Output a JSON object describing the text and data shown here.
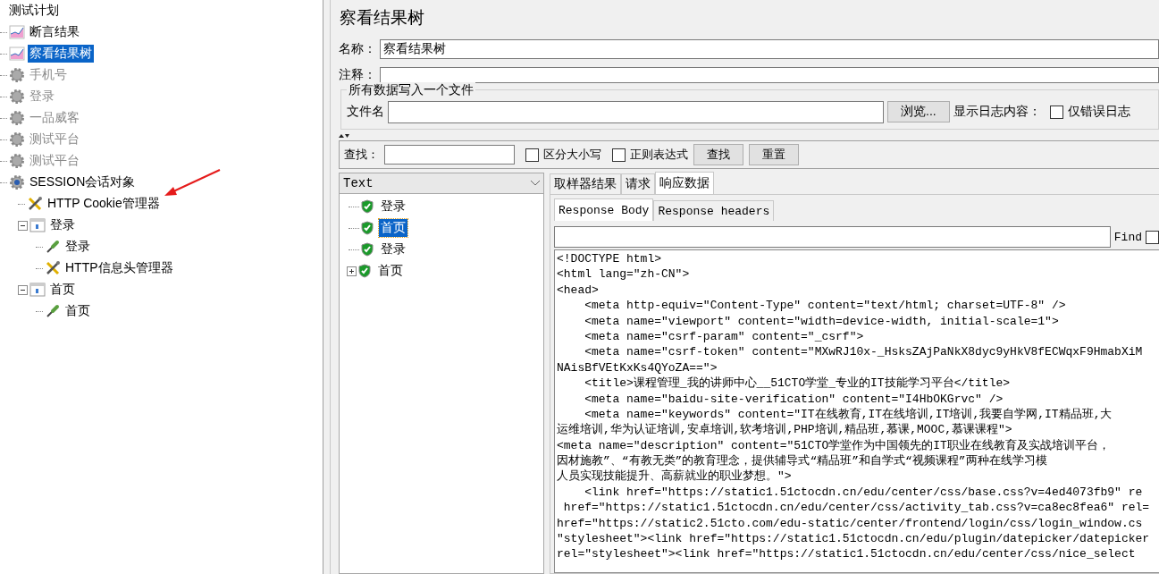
{
  "test_tree": {
    "label": "测试计划",
    "children": [
      {
        "label": "断言结果",
        "kind": "visualizer",
        "selected": false,
        "disabled": false
      },
      {
        "label": "察看结果树",
        "kind": "visualizer",
        "selected": true,
        "disabled": false
      },
      {
        "label": "手机号",
        "kind": "thread_group",
        "selected": false,
        "disabled": true
      },
      {
        "label": "登录",
        "kind": "thread_group",
        "selected": false,
        "disabled": true
      },
      {
        "label": "一品威客",
        "kind": "thread_group",
        "selected": false,
        "disabled": true
      },
      {
        "label": "测试平台",
        "kind": "thread_group",
        "selected": false,
        "disabled": true
      },
      {
        "label": "测试平台",
        "kind": "thread_group",
        "selected": false,
        "disabled": true
      },
      {
        "label": "SESSION会话对象",
        "kind": "session_group",
        "selected": false,
        "disabled": false,
        "children": [
          {
            "label": "HTTP Cookie管理器",
            "kind": "config",
            "selected": false,
            "disabled": false
          },
          {
            "label": "登录",
            "kind": "controller",
            "selected": false,
            "disabled": false,
            "expanded": true,
            "children": [
              {
                "label": "登录",
                "kind": "sampler",
                "selected": false,
                "disabled": false
              },
              {
                "label": "HTTP信息头管理器",
                "kind": "config",
                "selected": false,
                "disabled": false
              }
            ]
          },
          {
            "label": "首页",
            "kind": "controller",
            "selected": false,
            "disabled": false,
            "expanded": true,
            "children": [
              {
                "label": "首页",
                "kind": "sampler",
                "selected": false,
                "disabled": false
              }
            ]
          }
        ]
      }
    ]
  },
  "panel": {
    "title": "察看结果树",
    "name_label": "名称：",
    "name_value": "察看结果树",
    "comment_label": "注释：",
    "file_group": {
      "title": "所有数据写入一个文件",
      "file_label": "文件名",
      "browse_button": "浏览...",
      "log_label": "显示日志内容：",
      "errors_only": {
        "label": "仅错误日志",
        "checked": false
      }
    }
  },
  "search_bar": {
    "label": "查找：",
    "case_sensitive": {
      "label": "区分大小写",
      "checked": false
    },
    "regex": {
      "label": "正则表达式",
      "checked": false
    },
    "find_button": "查找",
    "reset_button": "重置"
  },
  "renderer": {
    "value": "Text"
  },
  "results": [
    {
      "label": "登录",
      "selected": false
    },
    {
      "label": "首页",
      "selected": true
    },
    {
      "label": "登录",
      "selected": false
    },
    {
      "label": "首页",
      "selected": false,
      "expanded": false
    }
  ],
  "tabs": [
    {
      "label": "取样器结果",
      "selected": false
    },
    {
      "label": "请求",
      "selected": false
    },
    {
      "label": "响应数据",
      "selected": true
    }
  ],
  "subtabs": [
    {
      "label": "Response Body",
      "selected": true
    },
    {
      "label": "Response headers",
      "selected": false
    }
  ],
  "find": {
    "label": "Find",
    "checked": false
  },
  "code_lines": [
    "<!DOCTYPE html>",
    "<html lang=\"zh-CN\">",
    "<head>",
    "    <meta http-equiv=\"Content-Type\" content=\"text/html; charset=UTF-8\" />",
    "    <meta name=\"viewport\" content=\"width=device-width, initial-scale=1\">",
    "    <meta name=\"csrf-param\" content=\"_csrf\">",
    "    <meta name=\"csrf-token\" content=\"MXwRJ10x-_HsksZAjPaNkX8dyc9yHkV8fECWqxF9HmabXiM",
    "NAisBfVEtKxKs4QYoZA==\">",
    "    <title>课程管理_我的讲师中心__51CTO学堂_专业的IT技能学习平台</title>",
    "    <meta name=\"baidu-site-verification\" content=\"I4HbOKGrvc\" />",
    "    <meta name=\"keywords\" content=\"IT在线教育,IT在线培训,IT培训,我要自学网,IT精品班,大",
    "运维培训,华为认证培训,安卓培训,软考培训,PHP培训,精品班,慕课,MOOC,慕课课程\">",
    "<meta name=\"description\" content=\"51CTO学堂作为中国领先的IT职业在线教育及实战培训平台，",
    "因材施教”、“有教无类”的教育理念，提供辅导式“精品班”和自学式“视频课程”两种在线学习模",
    "人员实现技能提升、高薪就业的职业梦想。\">",
    "    <link href=\"https://static1.51ctocdn.cn/edu/center/css/base.css?v=4ed4073fb9\" re",
    " href=\"https://static1.51ctocdn.cn/edu/center/css/activity_tab.css?v=ca8ec8fea6\" rel=",
    "href=\"https://static2.51cto.com/edu-static/center/frontend/login/css/login_window.cs",
    "\"stylesheet\"><link href=\"https://static1.51ctocdn.cn/edu/plugin/datepicker/datepicker",
    "rel=\"stylesheet\"><link href=\"https://static1.51ctocdn.cn/edu/center/css/nice_select"
  ]
}
